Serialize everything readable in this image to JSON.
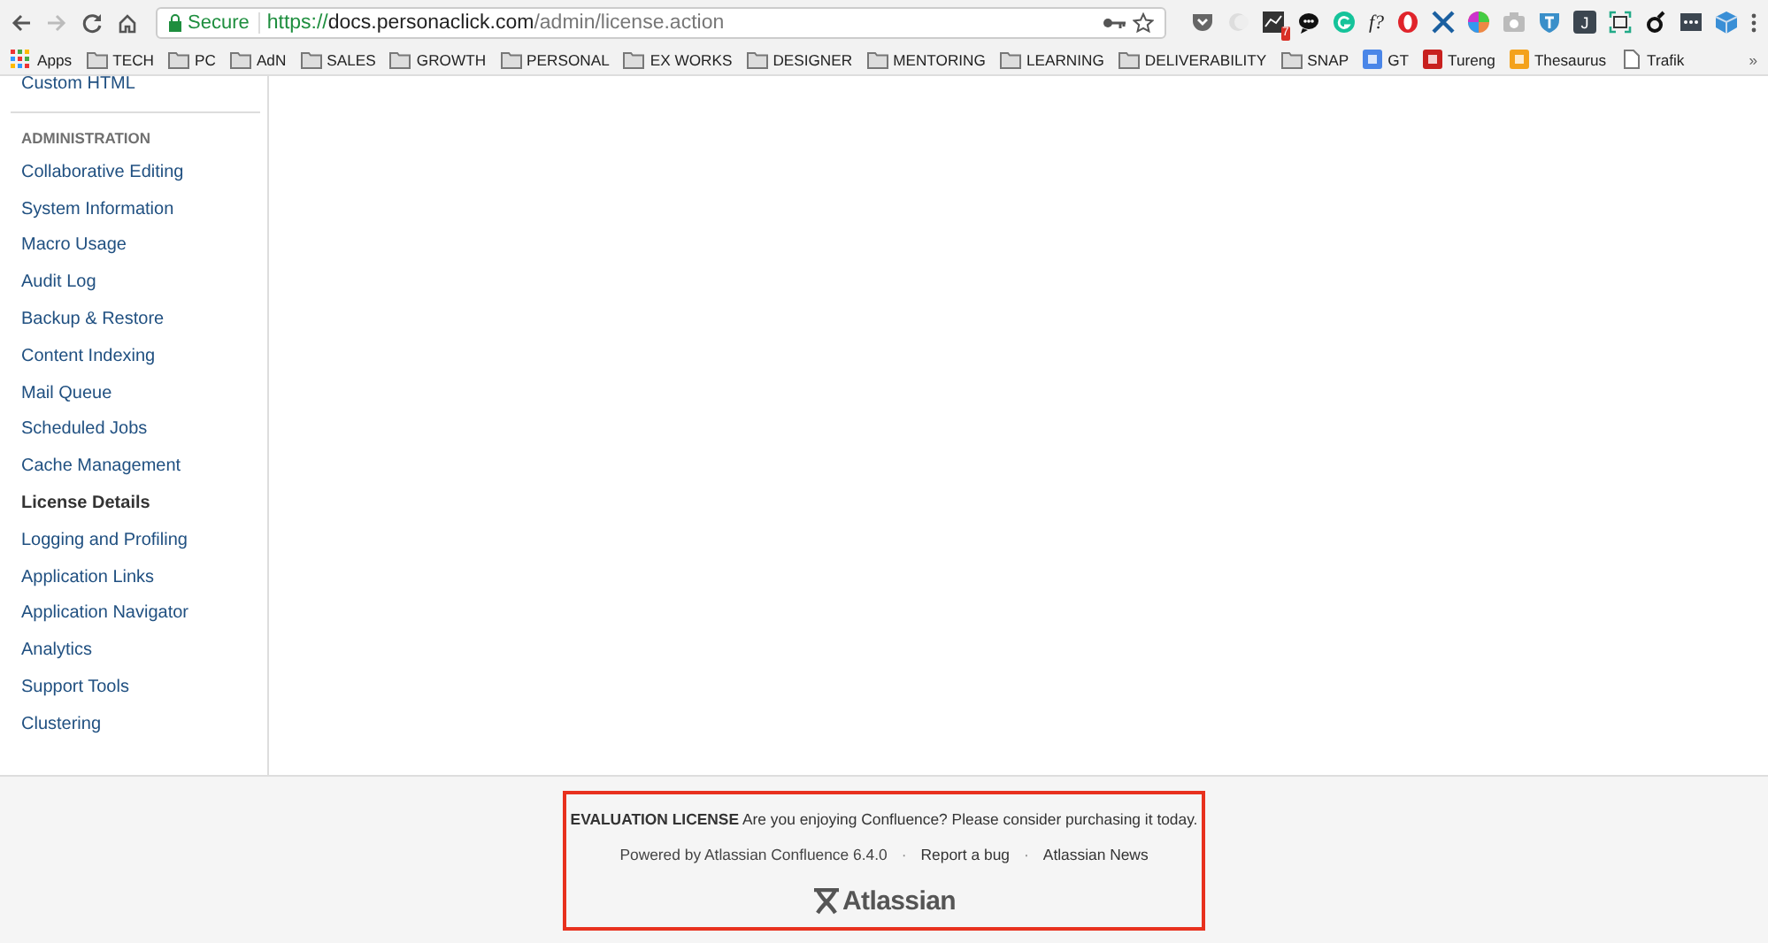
{
  "browser": {
    "address": {
      "secure_label": "Secure",
      "url_parts": [
        {
          "kind": "scheme",
          "text": "https://"
        },
        {
          "kind": "host",
          "text": "docs.personaclick.com"
        },
        {
          "kind": "path",
          "text": "/admin/license.action"
        }
      ]
    },
    "extensions": [
      {
        "kind": "pocket"
      },
      {
        "kind": "moon"
      },
      {
        "kind": "chart",
        "badge": "7"
      },
      {
        "kind": "chat"
      },
      {
        "kind": "grammar"
      },
      {
        "kind": "text",
        "glyph": "f?"
      },
      {
        "kind": "opera"
      },
      {
        "kind": "cross"
      },
      {
        "kind": "wheel"
      },
      {
        "kind": "camera"
      },
      {
        "kind": "shield"
      },
      {
        "kind": "letter",
        "glyph": "J"
      },
      {
        "kind": "frame"
      },
      {
        "kind": "swirl"
      },
      {
        "kind": "dots"
      },
      {
        "kind": "cube"
      }
    ],
    "bookmarks": [
      {
        "kind": "apps",
        "label": "Apps"
      },
      {
        "kind": "folder",
        "label": "TECH"
      },
      {
        "kind": "folder",
        "label": "PC"
      },
      {
        "kind": "folder",
        "label": "AdN"
      },
      {
        "kind": "folder",
        "label": "SALES"
      },
      {
        "kind": "folder",
        "label": "GROWTH"
      },
      {
        "kind": "folder",
        "label": "PERSONAL"
      },
      {
        "kind": "folder",
        "label": "EX WORKS"
      },
      {
        "kind": "folder",
        "label": "DESIGNER"
      },
      {
        "kind": "folder",
        "label": "MENTORING"
      },
      {
        "kind": "folder",
        "label": "LEARNING"
      },
      {
        "kind": "folder",
        "label": "DELIVERABILITY"
      },
      {
        "kind": "folder",
        "label": "SNAP"
      },
      {
        "kind": "site",
        "label": "GT",
        "color": "#4a86e8"
      },
      {
        "kind": "site",
        "label": "Tureng",
        "color": "#c8201e"
      },
      {
        "kind": "site",
        "label": "Thesaurus",
        "color": "#f4a21c"
      },
      {
        "kind": "page",
        "label": "Trafik"
      }
    ],
    "overflow": "»"
  },
  "sidebar": {
    "previous_item": "Custom HTML",
    "heading": "ADMINISTRATION",
    "items": [
      {
        "label": "Collaborative Editing",
        "selected": false
      },
      {
        "label": "System Information",
        "selected": false
      },
      {
        "label": "Macro Usage",
        "selected": false
      },
      {
        "label": "Audit Log",
        "selected": false
      },
      {
        "label": "Backup & Restore",
        "selected": false
      },
      {
        "label": "Content Indexing",
        "selected": false
      },
      {
        "label": "Mail Queue",
        "selected": false
      },
      {
        "label": "Scheduled Jobs",
        "selected": false
      },
      {
        "label": "Cache Management",
        "selected": false
      },
      {
        "label": "License Details",
        "selected": true
      },
      {
        "label": "Logging and Profiling",
        "selected": false
      },
      {
        "label": "Application Links",
        "selected": false
      },
      {
        "label": "Application Navigator",
        "selected": false
      },
      {
        "label": "Analytics",
        "selected": false
      },
      {
        "label": "Support Tools",
        "selected": false
      },
      {
        "label": "Clustering",
        "selected": false
      }
    ]
  },
  "footer": {
    "highlighted": true,
    "license_notice": "**EVALUATION LICENSE** Are you enjoying Confluence? Please consider purchasing it today.",
    "links": [
      {
        "kind": "text",
        "text": "Powered by Atlassian Confluence 6.4.0"
      },
      {
        "kind": "sep",
        "text": "·"
      },
      {
        "kind": "link",
        "text": "Report a bug"
      },
      {
        "kind": "sep",
        "text": "·"
      },
      {
        "kind": "link",
        "text": "Atlassian News"
      }
    ],
    "logo_text": "Atlassian"
  }
}
